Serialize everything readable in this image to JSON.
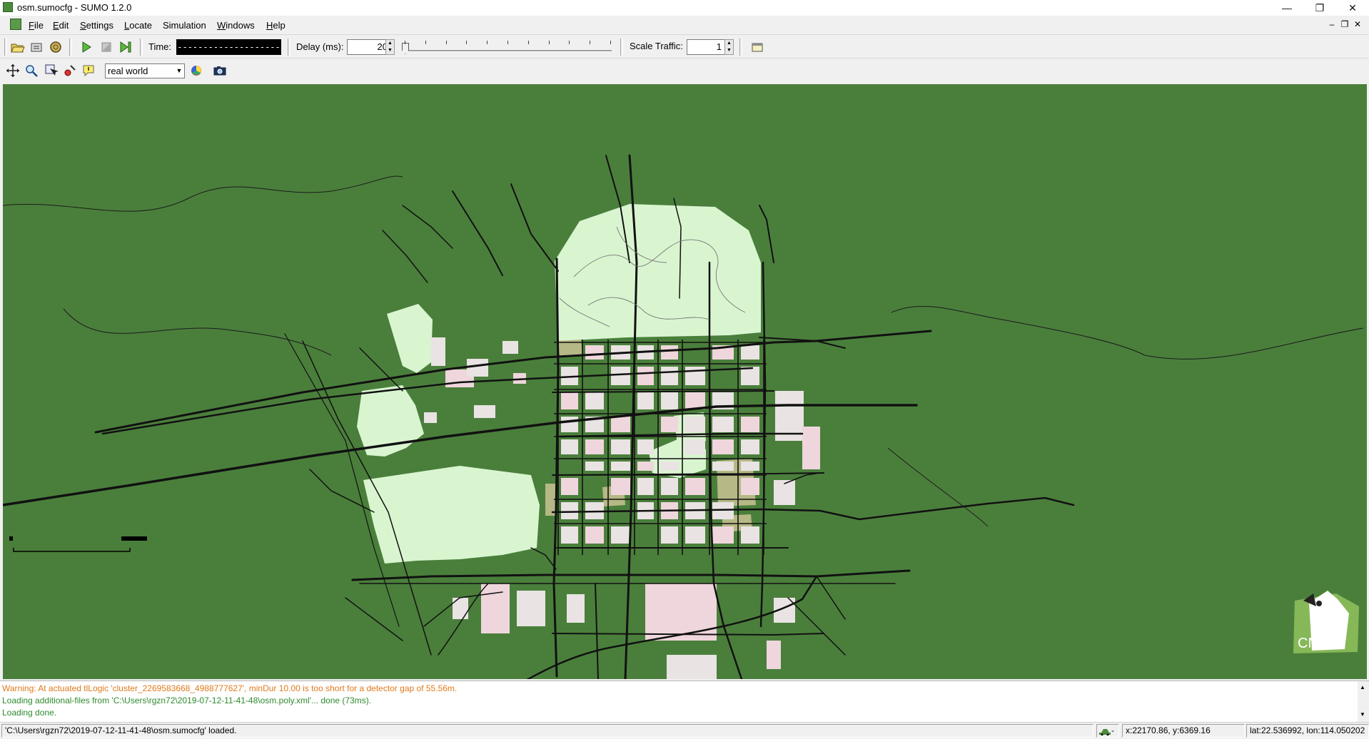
{
  "window": {
    "title": "osm.sumocfg - SUMO 1.2.0",
    "minimize_glyph": "—",
    "restore_glyph": "❐",
    "close_glyph": "✕"
  },
  "menu": {
    "items": [
      {
        "accel": "F",
        "rest": "ile"
      },
      {
        "accel": "E",
        "rest": "dit"
      },
      {
        "accel": "S",
        "rest": "ettings"
      },
      {
        "accel": "L",
        "rest": "ocate"
      },
      {
        "accel": "",
        "rest": "Simulation"
      },
      {
        "accel": "W",
        "rest": "indows"
      },
      {
        "accel": "H",
        "rest": "elp"
      }
    ],
    "mdi_minimize": "–",
    "mdi_restore": "❐",
    "mdi_close": "✕"
  },
  "toolbar": {
    "time_label": "Time:",
    "time_value": "--------------------",
    "delay_label": "Delay (ms):",
    "delay_value": "20",
    "delay_fraction": 0.0,
    "scale_label": "Scale Traffic:",
    "scale_value": "1"
  },
  "viewbar": {
    "scheme": "real world"
  },
  "icons": {
    "open": "folder-open-icon",
    "reload": "reload-icon",
    "close_sim": "close-simulation-icon",
    "run": "play-icon",
    "stop": "stop-icon",
    "step": "step-icon",
    "editor": "breakpoint-editor-icon",
    "recenter": "recenter-icon",
    "zoom": "zoom-icon",
    "locate": "locate-icon",
    "color": "color-settings-icon",
    "camera": "screenshot-icon"
  },
  "messages": [
    {
      "text": "Warning: At actuated tlLogic 'cluster_2269583668_4988777627', minDur 10.00 is too short for a detector gap of 55.56m.",
      "color": "#e07a1c"
    },
    {
      "text": "Loading additional-files from 'C:\\Users\\rgzn72\\2019-07-12-11-41-48\\osm.poly.xml'... done (73ms).",
      "color": "#2e8a2e"
    },
    {
      "text": "Loading done.",
      "color": "#2e8a2e"
    }
  ],
  "status": {
    "main": "'C:\\Users\\rgzn72\\2019-07-12-11-41-48\\osm.sumocfg' loaded.",
    "car_sep": "-",
    "xy": "x:22170.86, y:6369.16",
    "latlon": "lat:22.536992, lon:114.050202"
  },
  "logo": {
    "text": "CN"
  },
  "colors": {
    "map_bg": "#4a7f3b",
    "park": "#d9f5d0",
    "building": "#e9e3e3",
    "building_pink": "#efd6dc",
    "sand": "#b6b885",
    "road": "#111111"
  }
}
